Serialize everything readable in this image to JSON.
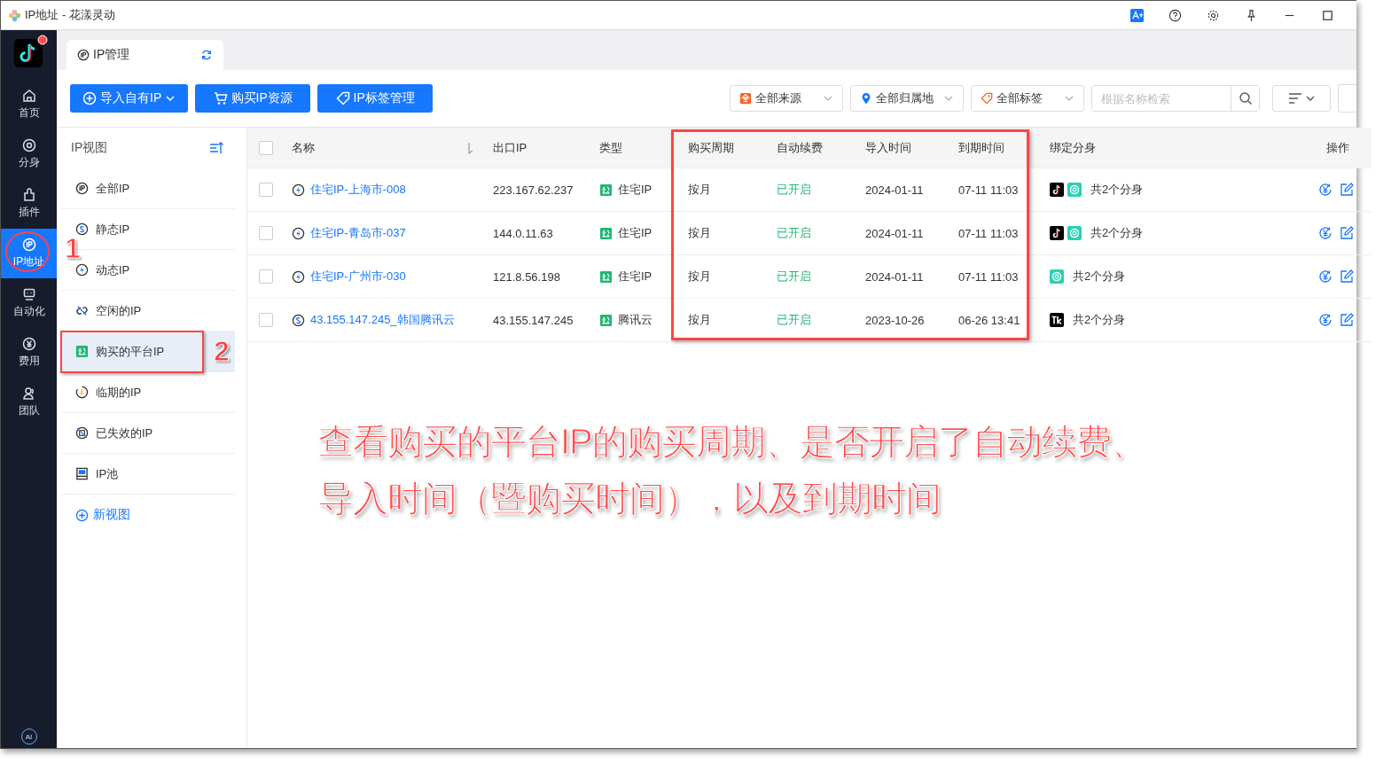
{
  "window": {
    "title": "IP地址 - 花漾灵动"
  },
  "nav": {
    "items": [
      {
        "label": "首页",
        "selected": false
      },
      {
        "label": "分身",
        "selected": false
      },
      {
        "label": "插件",
        "selected": false
      },
      {
        "label": "IP地址",
        "selected": true
      },
      {
        "label": "自动化",
        "selected": false
      },
      {
        "label": "费用",
        "selected": false
      },
      {
        "label": "团队",
        "selected": false
      }
    ],
    "ai_label": "AI"
  },
  "tab": {
    "label": "IP管理"
  },
  "toolbar": {
    "buttons": [
      {
        "label": "导入自有IP",
        "dropdown": true
      },
      {
        "label": "购买IP资源",
        "dropdown": false
      },
      {
        "label": "IP标签管理",
        "dropdown": false
      }
    ],
    "filters": [
      {
        "label": "全部来源"
      },
      {
        "label": "全部归属地"
      },
      {
        "label": "全部标签"
      }
    ],
    "search": {
      "placeholder": "根据名称检索"
    }
  },
  "views": {
    "title": "IP视图",
    "items": [
      {
        "label": "全部IP",
        "selected": false
      },
      {
        "label": "静态IP",
        "selected": false
      },
      {
        "label": "动态IP",
        "selected": false
      },
      {
        "label": "空闲的IP",
        "selected": false
      },
      {
        "label": "购买的平台IP",
        "selected": true
      },
      {
        "label": "临期的IP",
        "selected": false
      },
      {
        "label": "已失效的IP",
        "selected": false
      },
      {
        "label": "IP池",
        "selected": false
      }
    ],
    "add_label": "新视图"
  },
  "table": {
    "select_all": {
      "checked": false
    },
    "columns": [
      "名称",
      "出口IP",
      "类型",
      "购买周期",
      "自动续费",
      "导入时间",
      "到期时间",
      "绑定分身",
      "操作"
    ],
    "rows": [
      {
        "checked": false,
        "kind": "dynamic",
        "name": "住宅IP-上海市-008",
        "ip": "223.167.62.237",
        "type": "住宅IP",
        "cycle": "按月",
        "auto_renew": "已开启",
        "imported": "2024-01-11",
        "expires": "07-11 11:03",
        "apps": [
          {
            "kind": "tiktok"
          },
          {
            "kind": "browser"
          }
        ],
        "bound": "共2个分身"
      },
      {
        "checked": false,
        "kind": "dynamic",
        "name": "住宅IP-青岛市-037",
        "ip": "144.0.11.63",
        "type": "住宅IP",
        "cycle": "按月",
        "auto_renew": "已开启",
        "imported": "2024-01-11",
        "expires": "07-11 11:03",
        "apps": [
          {
            "kind": "tiktok"
          },
          {
            "kind": "browser"
          }
        ],
        "bound": "共2个分身"
      },
      {
        "checked": false,
        "kind": "dynamic",
        "name": "住宅IP-广州市-030",
        "ip": "121.8.56.198",
        "type": "住宅IP",
        "cycle": "按月",
        "auto_renew": "已开启",
        "imported": "2024-01-11",
        "expires": "07-11 11:03",
        "apps": [
          {
            "kind": "browser"
          }
        ],
        "bound": "共2个分身"
      },
      {
        "checked": false,
        "kind": "static",
        "name": "43.155.147.245_韩国腾讯云",
        "ip": "43.155.147.245",
        "type": "腾讯云",
        "cycle": "按月",
        "auto_renew": "已开启",
        "imported": "2023-10-26",
        "expires": "06-26 13:41",
        "apps": [
          {
            "kind": "tk"
          }
        ],
        "bound": "共2个分身"
      }
    ]
  },
  "annotations": {
    "markers": [
      "1",
      "2"
    ],
    "caption": [
      "查看购买的平台IP的购买周期、是否开启了自动续费、",
      "导入时间（暨购买时间），以及到期时间"
    ]
  }
}
